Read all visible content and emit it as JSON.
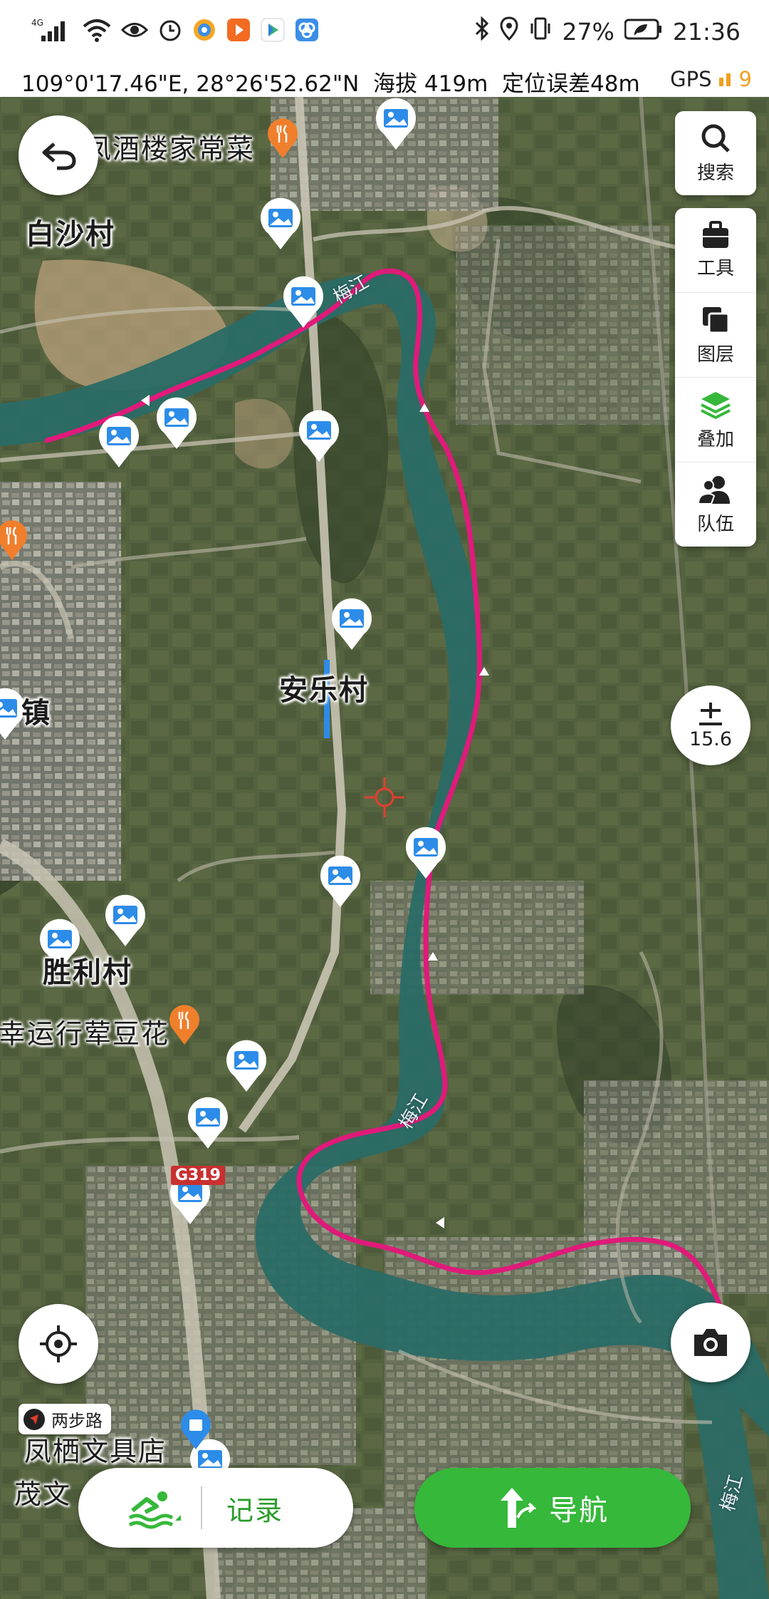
{
  "status_bar": {
    "network": "4G",
    "battery_pct": "27%",
    "time": "21:36",
    "app_icons": [
      "eye-icon",
      "alarm-icon",
      "browser-icon",
      "video-icon",
      "tv-icon",
      "app-icon"
    ]
  },
  "location_bar": {
    "coords": "109°0'17.46\"E, 28°26'52.62\"N",
    "altitude": "海拔 419m",
    "accuracy": "定位误差48m",
    "gps_label": "GPS",
    "gps_count": "9"
  },
  "map": {
    "labels": {
      "baisha": "白沙村",
      "anle": "安乐村",
      "shengli": "胜利村",
      "zhen": "镇",
      "restaurant_top": "凤酒楼家常菜",
      "restaurant_mid": "幸运行荤豆花",
      "stationery": "凤栖文具店",
      "maowen": "茂文",
      "river1": "梅江",
      "river2": "梅江",
      "river3": "梅江",
      "road": "G319"
    },
    "track_color": "#e01a7a",
    "accent_color": "#36b83b"
  },
  "toolbar": {
    "items": [
      {
        "label": "搜索",
        "icon": "search-icon"
      },
      {
        "label": "工具",
        "icon": "toolbox-icon"
      },
      {
        "label": "图层",
        "icon": "layers-icon"
      },
      {
        "label": "叠加",
        "icon": "overlay-icon"
      },
      {
        "label": "队伍",
        "icon": "team-icon"
      }
    ]
  },
  "zoom": {
    "level": "15.6"
  },
  "tag": {
    "label": "两步路"
  },
  "bottom": {
    "record_label": "记录",
    "navigate_label": "导航"
  }
}
